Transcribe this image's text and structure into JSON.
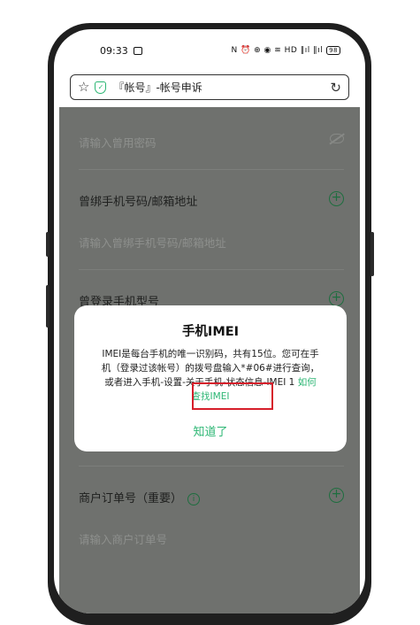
{
  "status_bar": {
    "time": "09:33",
    "right_icons": "N ⏰ ⊕ ◉ ≋ HD ‖ıl ‖ıl",
    "battery": "98"
  },
  "browser": {
    "url": "『帐号』-帐号申诉",
    "icons": [
      "star-icon",
      "shield-check-icon",
      "refresh-icon"
    ]
  },
  "form": {
    "password_placeholder": "请输入曾用密码",
    "bound_phone_label": "曾绑手机号码/邮箱地址",
    "bound_phone_placeholder": "请输入曾绑手机号码/邮箱地址",
    "device_model_label": "曾登录手机型号",
    "order_label": "商户订单号（重要）",
    "order_placeholder": "请输入商户订单号"
  },
  "dialog": {
    "title": "手机IMEI",
    "body": "IMEI是每台手机的唯一识别码，共有15位。您可在手机（登录过该帐号）的拨号盘输入*#06#进行查询，或者进入手机-设置-关于手机-状态信息-IMEI 1",
    "link": "如何查找IMEI",
    "ok": "知道了"
  },
  "colors": {
    "accent": "#2bb673",
    "overlay": "#6f716e",
    "highlight": "#d61f2b"
  }
}
